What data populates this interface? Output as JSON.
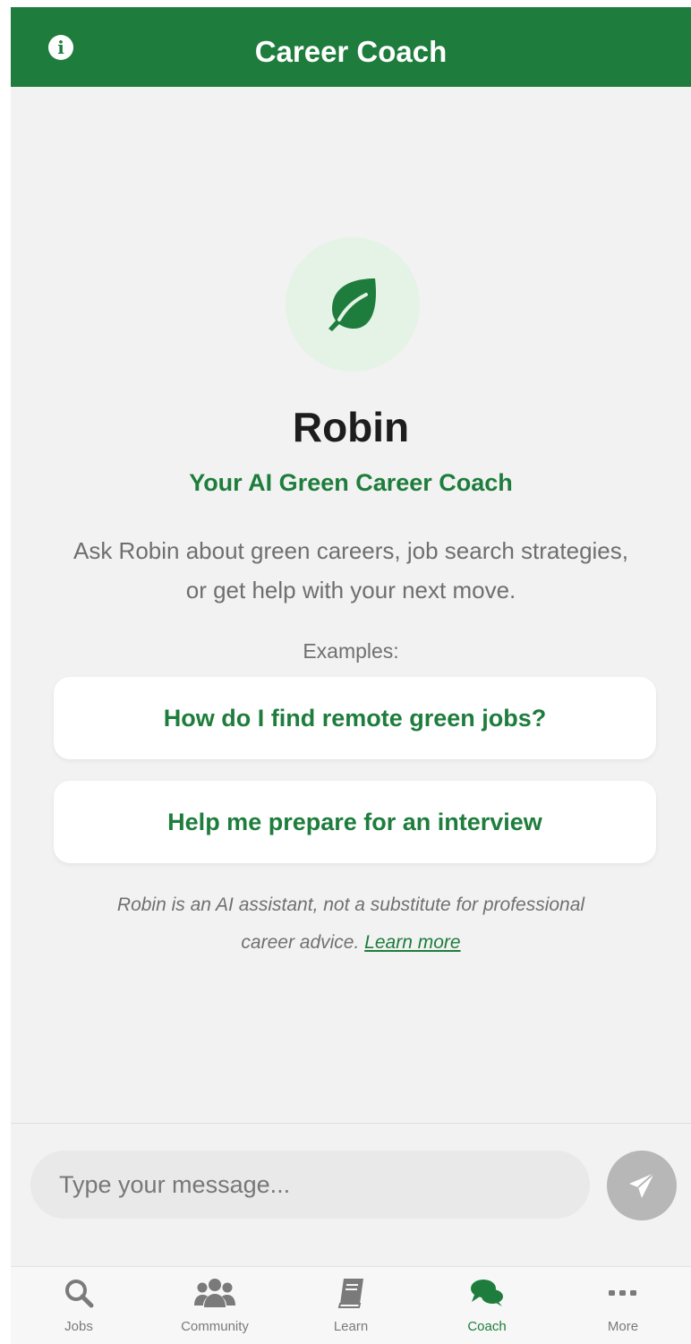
{
  "header": {
    "title": "Career Coach",
    "info_icon": "info-circle-icon"
  },
  "coach": {
    "avatar_icon": "leaf-icon",
    "name": "Robin",
    "subtitle": "Your AI Green Career Coach",
    "description": "Ask Robin about green careers, job search strategies, or get help with your next move."
  },
  "examples": {
    "label": "Examples:",
    "items": [
      "How do I find remote green jobs?",
      "Help me prepare for an interview"
    ]
  },
  "disclaimer": {
    "text": "Robin is an AI assistant, not a substitute for professional career advice.",
    "link_label": "Learn more"
  },
  "composer": {
    "placeholder": "Type your message...",
    "send_icon": "paper-plane-icon"
  },
  "tabs": [
    {
      "label": "Jobs",
      "icon": "search-icon",
      "active": false
    },
    {
      "label": "Community",
      "icon": "users-icon",
      "active": false
    },
    {
      "label": "Learn",
      "icon": "book-icon",
      "active": false
    },
    {
      "label": "Coach",
      "icon": "chat-bubbles-icon",
      "active": true
    },
    {
      "label": "More",
      "icon": "ellipsis-icon",
      "active": false
    }
  ],
  "colors": {
    "brand_green": "#1e7d3c",
    "background": "#f2f2f2",
    "avatar_bg": "#e4f3e6",
    "send_disabled": "#b7b7b7",
    "inactive_tab": "#7a7a7a"
  }
}
